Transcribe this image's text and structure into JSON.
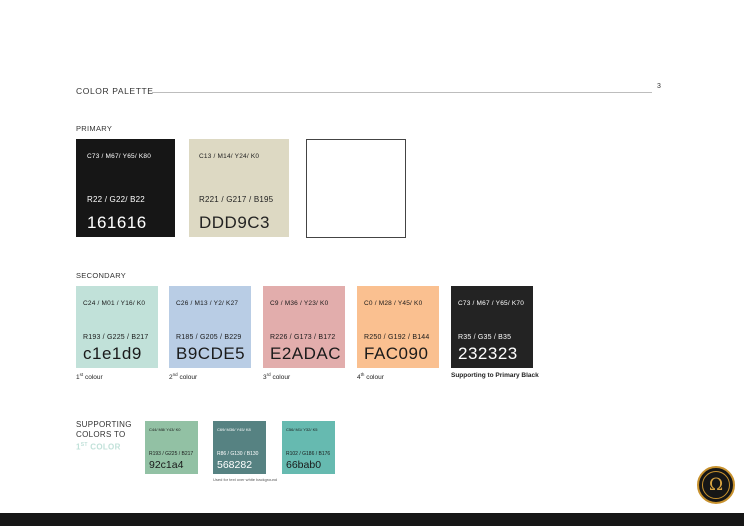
{
  "header": {
    "title": "COLOR PALETTE",
    "page_number": "3"
  },
  "primary": {
    "label": "PRIMARY",
    "swatches": [
      {
        "cmyk": "C73 / M67/ Y65/ K80",
        "rgb": "R22 / G22/ B22",
        "hex": "161616",
        "color": "#161616",
        "text_color": "#ffffff"
      },
      {
        "cmyk": "C13 / M14/ Y24/ K0",
        "rgb": "R221 / G217 / B195",
        "hex": "DDD9C3",
        "color": "#DDD9C3",
        "text_color": "#222222"
      },
      {
        "color": "#FFFFFF"
      }
    ]
  },
  "secondary": {
    "label": "SECONDARY",
    "swatches": [
      {
        "cmyk": "C24 / M01 / Y16/ K0",
        "rgb": "R193 / G225 / B217",
        "hex": "c1e1d9",
        "color": "#c1e1d9",
        "text_color": "#1a1a1a",
        "caption_num": "1",
        "caption_sup": "st",
        "caption_text": " colour"
      },
      {
        "cmyk": "C26 / M13 / Y2/ K27",
        "rgb": "R185 / G205 / B229",
        "hex": "B9CDE5",
        "color": "#B9CDE5",
        "text_color": "#1a1a1a",
        "caption_num": "2",
        "caption_sup": "nd",
        "caption_text": " colour"
      },
      {
        "cmyk": "C9 / M36 / Y23/ K0",
        "rgb": "R226 / G173 / B172",
        "hex": "E2ADAC",
        "color": "#E2ADAC",
        "text_color": "#1a1a1a",
        "caption_num": "3",
        "caption_sup": "rd",
        "caption_text": " colour"
      },
      {
        "cmyk": "C0 / M28 / Y45/ K0",
        "rgb": "R250 / G192 / B144",
        "hex": "FAC090",
        "color": "#FAC090",
        "text_color": "#1a1a1a",
        "caption_num": "4",
        "caption_sup": "th",
        "caption_text": " colour"
      },
      {
        "cmyk": "C73 / M67 / Y65/ K70",
        "rgb": "R35 / G35 / B35",
        "hex": "232323",
        "color": "#232323",
        "text_color": "#ffffff",
        "caption_num": "",
        "caption_sup": "",
        "caption_text": "Supporting to Primary Black"
      }
    ]
  },
  "supporting": {
    "title_line1": "SUPPORTING",
    "title_line2": "COLORS TO",
    "title_accent_num": "1",
    "title_accent_sup": "ST",
    "title_accent_word": " COLOR",
    "swatches": [
      {
        "cmyk": "C44/ M8/ Y43/ K0",
        "rgb": "R193 / G225 / B217",
        "hex": "92c1a4",
        "color": "#92c1a4",
        "text_color": "#1a1a1a"
      },
      {
        "cmyk": "C69/ M36/ Y45/ K8",
        "rgb": "R86 / G130 / B130",
        "hex": "568282",
        "color": "#568282",
        "text_color": "#ffffff"
      },
      {
        "cmyk": "C56/ M1/ Y32/ K5",
        "rgb": "R102 / G186 / B176",
        "hex": "66bab0",
        "color": "#66bab0",
        "text_color": "#1a1a1a"
      }
    ],
    "note": "Used for text over white background"
  },
  "colors": {
    "footer": "#161616",
    "logo_gold": "#c8922e",
    "accent": "#c1e1d9"
  },
  "logo": {
    "glyph": "Ω",
    "icon": "brand-logo-icon"
  }
}
